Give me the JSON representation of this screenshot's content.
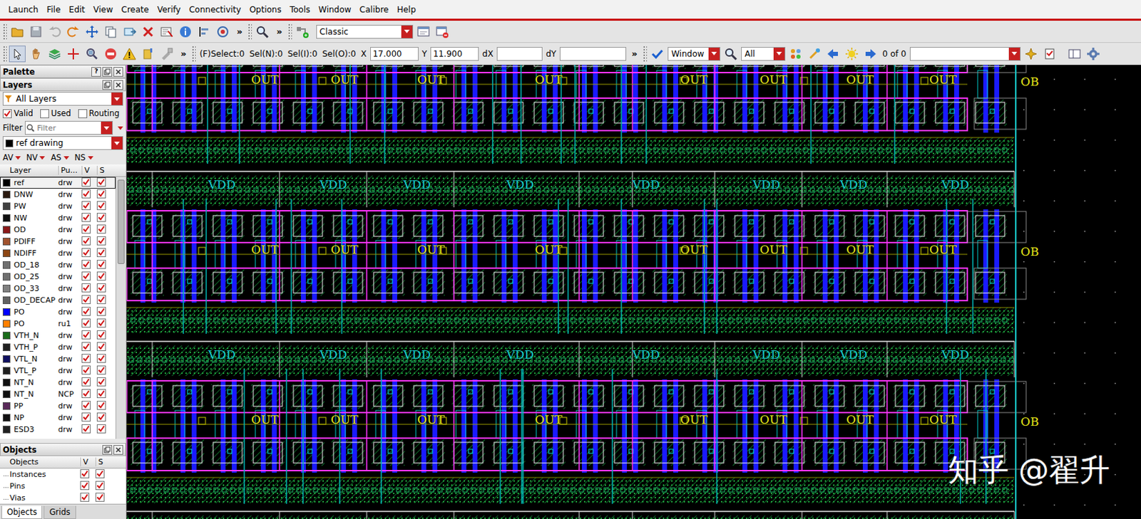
{
  "menu": [
    "Launch",
    "File",
    "Edit",
    "View",
    "Create",
    "Verify",
    "Connectivity",
    "Options",
    "Tools",
    "Window",
    "Calibre",
    "Help"
  ],
  "toolbar1": {
    "more": [
      "»",
      "»"
    ],
    "view_mode": "Classic"
  },
  "toolbar2": {
    "more": "»",
    "select": "(F)Select:0",
    "sel_n": "Sel(N):0",
    "sel_i": "Sel(I):0",
    "sel_o": "Sel(O):0",
    "x_label": "X",
    "x": "17.000",
    "y_label": "Y",
    "y": "11.900",
    "dx_label": "dX",
    "dx": "",
    "dy_label": "dY",
    "dy": "",
    "more2": "»",
    "zoom_mode": "Window",
    "filter": "All",
    "count": "0 of 0",
    "find": ""
  },
  "palette": {
    "title": "Palette",
    "help": "?"
  },
  "layers_panel": {
    "title": "Layers",
    "filter": "All Layers",
    "options": [
      {
        "label": "Valid",
        "checked": true
      },
      {
        "label": "Used",
        "checked": false
      },
      {
        "label": "Routing",
        "checked": false
      }
    ],
    "filter_button": "Filter",
    "search_placeholder": "Filter",
    "current": {
      "label": "ref drawing",
      "color": "#000000"
    },
    "visibility": [
      "AV",
      "NV",
      "AS",
      "NS"
    ],
    "columns": [
      "Layer",
      "Pu...",
      "V",
      "S"
    ],
    "rows": [
      {
        "layer": "ref",
        "purpose": "drw",
        "color": "#000000",
        "visible": true,
        "selectable": true,
        "selected": true
      },
      {
        "layer": "DNW",
        "purpose": "drw",
        "color": "#2b1a10",
        "visible": true,
        "selectable": true,
        "selected": false
      },
      {
        "layer": "PW",
        "purpose": "drw",
        "color": "#404040",
        "visible": true,
        "selectable": true,
        "selected": false
      },
      {
        "layer": "NW",
        "purpose": "drw",
        "color": "#101010",
        "visible": true,
        "selectable": true,
        "selected": false
      },
      {
        "layer": "OD",
        "purpose": "drw",
        "color": "#8b1a1a",
        "visible": true,
        "selectable": true,
        "selected": false
      },
      {
        "layer": "PDIFF",
        "purpose": "drw",
        "color": "#a0522d",
        "visible": true,
        "selectable": true,
        "selected": false
      },
      {
        "layer": "NDIFF",
        "purpose": "drw",
        "color": "#8b4513",
        "visible": true,
        "selectable": true,
        "selected": false
      },
      {
        "layer": "OD_18",
        "purpose": "drw",
        "color": "#707070",
        "visible": true,
        "selectable": true,
        "selected": false
      },
      {
        "layer": "OD_25",
        "purpose": "drw",
        "color": "#707070",
        "visible": true,
        "selectable": true,
        "selected": false
      },
      {
        "layer": "OD_33",
        "purpose": "drw",
        "color": "#808080",
        "visible": true,
        "selectable": true,
        "selected": false
      },
      {
        "layer": "OD_DECAP",
        "purpose": "drw",
        "color": "#606060",
        "visible": true,
        "selectable": true,
        "selected": false
      },
      {
        "layer": "PO",
        "purpose": "drw",
        "color": "#0000ff",
        "visible": true,
        "selectable": true,
        "selected": false
      },
      {
        "layer": "PO",
        "purpose": "ru1",
        "color": "#ff8000",
        "visible": true,
        "selectable": true,
        "selected": false
      },
      {
        "layer": "VTH_N",
        "purpose": "drw",
        "color": "#1a6b1a",
        "visible": true,
        "selectable": true,
        "selected": false
      },
      {
        "layer": "VTH_P",
        "purpose": "drw",
        "color": "#202020",
        "visible": true,
        "selectable": true,
        "selected": false
      },
      {
        "layer": "VTL_N",
        "purpose": "drw",
        "color": "#101060",
        "visible": true,
        "selectable": true,
        "selected": false
      },
      {
        "layer": "VTL_P",
        "purpose": "drw",
        "color": "#202020",
        "visible": true,
        "selectable": true,
        "selected": false
      },
      {
        "layer": "NT_N",
        "purpose": "drw",
        "color": "#101010",
        "visible": true,
        "selectable": true,
        "selected": false
      },
      {
        "layer": "NT_N",
        "purpose": "NCP",
        "color": "#101010",
        "visible": true,
        "selectable": true,
        "selected": false
      },
      {
        "layer": "PP",
        "purpose": "drw",
        "color": "#5a2a5a",
        "visible": true,
        "selectable": true,
        "selected": false
      },
      {
        "layer": "NP",
        "purpose": "drw",
        "color": "#101010",
        "visible": true,
        "selectable": true,
        "selected": false
      },
      {
        "layer": "ESD3",
        "purpose": "drw",
        "color": "#202020",
        "visible": true,
        "selectable": true,
        "selected": false
      }
    ]
  },
  "objects_panel": {
    "title": "Objects",
    "columns": [
      "Objects",
      "V",
      "S"
    ],
    "rows": [
      {
        "name": "Instances",
        "visible": true,
        "selectable": true
      },
      {
        "name": "Pins",
        "visible": true,
        "selectable": true
      },
      {
        "name": "Vias",
        "visible": true,
        "selectable": true
      }
    ]
  },
  "bottom_tabs": [
    {
      "label": "Objects",
      "selected": true
    },
    {
      "label": "Grids",
      "selected": false
    }
  ],
  "canvas": {
    "rows": [
      {
        "vdd": [],
        "out": [
          "OUT",
          "OUT",
          "OUT",
          "OUT",
          "OUT",
          "OUT",
          "OUT",
          "OUT"
        ],
        "edge": "OB"
      },
      {
        "vdd": [
          "VDD",
          "VDD",
          "VDD",
          "VDD",
          "VDD",
          "VDD",
          "VDD",
          "VDD"
        ],
        "out": [
          "OUT",
          "OUT",
          "OUT",
          "OUT",
          "OUT",
          "OUT",
          "OUT",
          "OUT"
        ],
        "edge": "OB"
      },
      {
        "vdd": [
          "VDD",
          "VDD",
          "VDD",
          "VDD",
          "VDD",
          "VDD",
          "VDD",
          "VDD"
        ],
        "out": [
          "OUT",
          "OUT",
          "OUT",
          "OUT",
          "OUT",
          "OUT",
          "OUT",
          "OUT"
        ],
        "edge": "OB"
      }
    ]
  },
  "watermark": "知乎 @翟升"
}
